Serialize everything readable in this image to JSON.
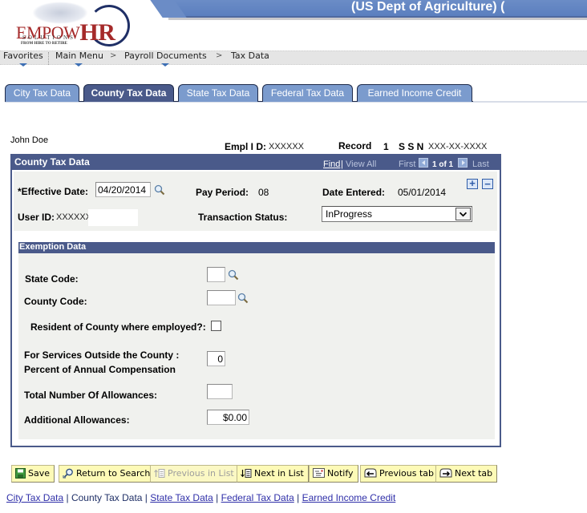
{
  "header": {
    "banner_title": "(US Dept of Agriculture) (",
    "logo": {
      "brand_left": "EMPOW",
      "brand_right": "HR",
      "sub": "SOLUTIONS",
      "tagline": "FROM HIRE TO RETIRE"
    }
  },
  "breadcrumb": {
    "items": [
      "Favorites",
      "Main Menu",
      "Payroll Documents",
      "Tax Data"
    ],
    "separator": ">"
  },
  "tabs": [
    {
      "label": "City Tax Data",
      "active": false
    },
    {
      "label": "County Tax Data",
      "active": true
    },
    {
      "label": "State Tax Data",
      "active": false
    },
    {
      "label": "Federal Tax Data",
      "active": false
    },
    {
      "label": "Earned Income Credit",
      "active": false
    }
  ],
  "employee": {
    "name": "John Doe",
    "empl_id_label": "Empl I D:",
    "empl_id": "XXXXXX",
    "record_label": "Record",
    "record": "1",
    "ssn_label": "S S N",
    "ssn": "XXX-XX-XXXX"
  },
  "panel": {
    "title": "County Tax Data",
    "find": "Find",
    "view_all": "View All",
    "first": "First",
    "count": "1 of 1",
    "last": "Last",
    "add_label": "+",
    "remove_label": "−",
    "effective_date_label": "*Effective Date:",
    "effective_date": "04/20/2014",
    "pay_period_label": "Pay Period:",
    "pay_period": "08",
    "date_entered_label": "Date Entered:",
    "date_entered": "05/01/2014",
    "user_id_label": "User ID:",
    "user_id": "XXXXXX",
    "transaction_status_label": "Transaction Status:",
    "transaction_status": "InProgress"
  },
  "exemption": {
    "title": "Exemption Data",
    "state_code_label": "State Code:",
    "state_code": "",
    "county_code_label": "County Code:",
    "county_code": "",
    "resident_label": "Resident of County where employed?:",
    "resident_checked": false,
    "services_label_1": "For Services Outside the County :",
    "services_label_2": "Percent of Annual Compensation",
    "services_value": "0",
    "total_allowances_label": "Total Number Of Allowances:",
    "total_allowances": "",
    "additional_allowances_label": "Additional Allowances:",
    "additional_allowances": "$0.00"
  },
  "toolbar": {
    "save": "Save",
    "return_to_search": "Return to Search",
    "previous_in_list": "Previous in List",
    "next_in_list": "Next in List",
    "notify": "Notify",
    "previous_tab": "Previous tab",
    "next_tab": "Next tab"
  },
  "footer_links": [
    {
      "label": "City Tax Data",
      "current": false
    },
    {
      "label": "County Tax Data",
      "current": true
    },
    {
      "label": "State Tax Data",
      "current": false
    },
    {
      "label": "Federal Tax Data",
      "current": false
    },
    {
      "label": "Earned Income Credit",
      "current": false
    }
  ],
  "colors": {
    "brand_navy": "#4a5a8a",
    "tab_inactive": "#7b9bcd",
    "button_yellow": "#fdfab7",
    "panel_bg": "#f0f1ee",
    "link": "#2e2ea8"
  }
}
